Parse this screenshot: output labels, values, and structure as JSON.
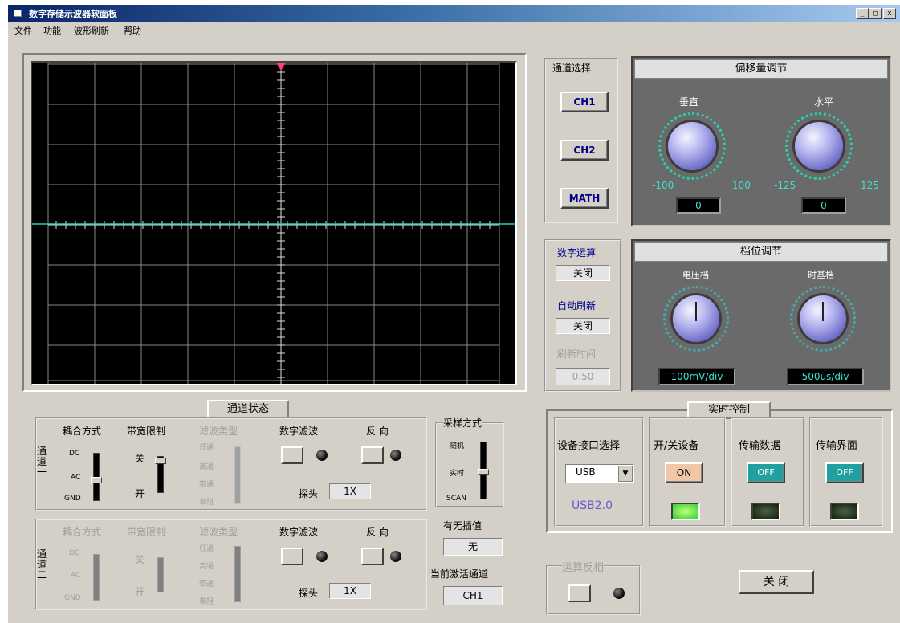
{
  "window": {
    "title": "数字存储示波器软面板",
    "min": "_",
    "max": "□",
    "close": "x"
  },
  "menu": [
    "文件",
    "功能",
    "波形刷新",
    "帮助"
  ],
  "channel_select": {
    "title": "通道选择",
    "buttons": [
      "CH1",
      "CH2",
      "MATH"
    ]
  },
  "offset": {
    "title": "偏移量调节",
    "vertical": {
      "label": "垂直",
      "min": "-100",
      "max": "100",
      "value": "0"
    },
    "horizontal": {
      "label": "水平",
      "min": "-125",
      "max": "125",
      "value": "0"
    }
  },
  "math": {
    "label": "数字运算",
    "value": "关闭",
    "auto_refresh_label": "自动刷新",
    "auto_refresh_value": "关闭",
    "refresh_time_label": "刷新时间",
    "refresh_time_value": "0.50"
  },
  "range": {
    "title": "档位调节",
    "voltage": {
      "label": "电压档",
      "value": "100mV/div"
    },
    "time": {
      "label": "时基档",
      "value": "500us/div"
    }
  },
  "channel_status": {
    "title": "通道状态",
    "ch1": {
      "label": "通\n道\n一",
      "coupling_label": "耦合方式",
      "coupling_opts": [
        "DC",
        "AC",
        "GND"
      ],
      "bw_label": "带宽限制",
      "bw_opts": [
        "关",
        "开"
      ],
      "filter_type_label": "滤波类型",
      "filter_opts": [
        "低通",
        "高通",
        "带通",
        "带阻"
      ],
      "digital_filter_label": "数字滤波",
      "invert_label": "反 向",
      "probe_label": "探头",
      "probe_value": "1X"
    },
    "ch2": {
      "label": "通\n道\n二",
      "coupling_label": "耦合方式",
      "coupling_opts": [
        "DC",
        "AC",
        "GND"
      ],
      "bw_label": "带宽限制",
      "bw_opts": [
        "关",
        "开"
      ],
      "filter_type_label": "滤波类型",
      "filter_opts": [
        "低通",
        "高通",
        "带通",
        "带阻"
      ],
      "digital_filter_label": "数字滤波",
      "invert_label": "反 向",
      "probe_label": "探头",
      "probe_value": "1X"
    }
  },
  "sampling": {
    "title": "采样方式",
    "opts": [
      "随机",
      "实时",
      "SCAN"
    ]
  },
  "interp": {
    "label": "有无插值",
    "value": "无"
  },
  "active_channel": {
    "label": "当前激活通道",
    "value": "CH1"
  },
  "invert_calc": {
    "label": "运算反相"
  },
  "realtime": {
    "title": "实时控制",
    "port": {
      "label": "设备接口选择",
      "value": "USB",
      "version": "USB2.0"
    },
    "device": {
      "label": "开/关设备",
      "button": "ON"
    },
    "data": {
      "label": "传输数据",
      "button": "OFF"
    },
    "ui": {
      "label": "传输界面",
      "button": "OFF"
    }
  },
  "close_button": "关 闭"
}
